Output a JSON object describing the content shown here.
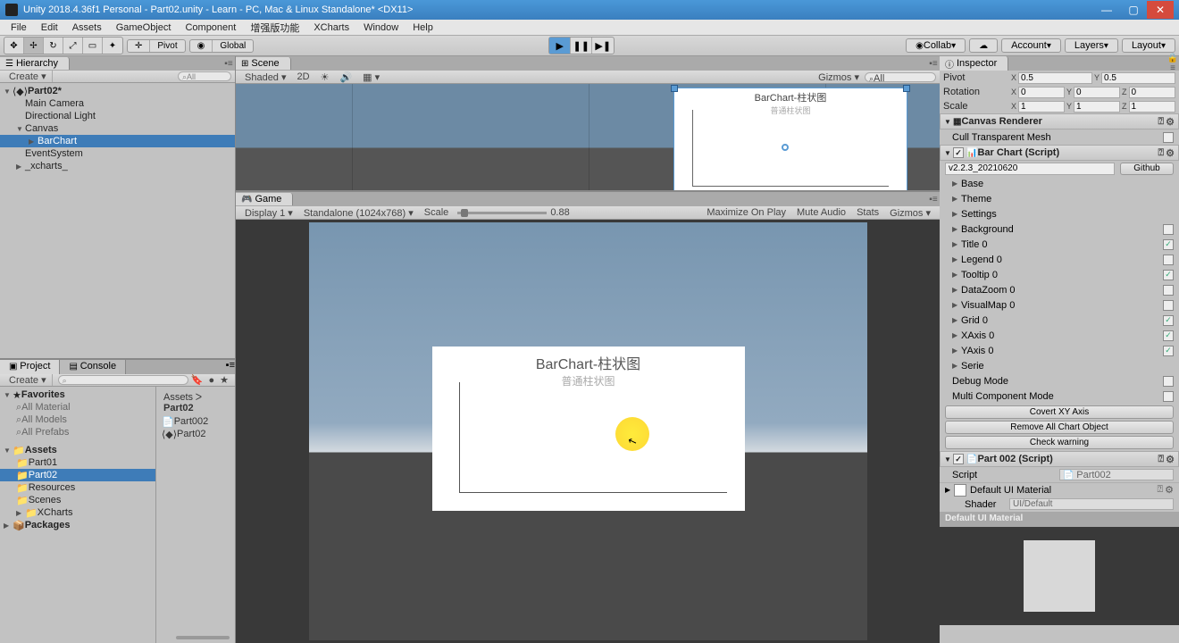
{
  "window": {
    "title": "Unity 2018.4.36f1 Personal - Part02.unity - Learn - PC, Mac & Linux Standalone* <DX11>",
    "min": "—",
    "max": "▢",
    "close": "✕"
  },
  "menu": [
    "File",
    "Edit",
    "Assets",
    "GameObject",
    "Component",
    "增强版功能",
    "XCharts",
    "Window",
    "Help"
  ],
  "toolbar": {
    "pivot": "Pivot",
    "global": "Global",
    "collab": "Collab",
    "account": "Account",
    "layers": "Layers",
    "layout": "Layout"
  },
  "hierarchy": {
    "tab": "Hierarchy",
    "create": "Create",
    "scene": "Part02*",
    "items": [
      "Main Camera",
      "Directional Light",
      "Canvas",
      "BarChart",
      "EventSystem",
      "_xcharts_"
    ]
  },
  "project": {
    "tab1": "Project",
    "tab2": "Console",
    "create": "Create",
    "fav": "Favorites",
    "favs": [
      "All Material",
      "All Models",
      "All Prefabs"
    ],
    "assets": "Assets",
    "folders": [
      "Part01",
      "Part02",
      "Resources",
      "Scenes",
      "XCharts"
    ],
    "packages": "Packages",
    "crumb_root": "Assets",
    "crumb_leaf": "Part02",
    "files": [
      "Part002",
      "Part02"
    ]
  },
  "scene": {
    "tab": "Scene",
    "shaded": "Shaded",
    "mode2d": "2D",
    "gizmos": "Gizmos",
    "search": "All",
    "chart_title": "BarChart-柱状图",
    "chart_sub": "普通柱状图"
  },
  "game": {
    "tab": "Game",
    "display": "Display 1",
    "res": "Standalone (1024x768)",
    "scale_lbl": "Scale",
    "scale_val": "0.88",
    "max": "Maximize On Play",
    "mute": "Mute Audio",
    "stats": "Stats",
    "gizmos": "Gizmos",
    "chart_title": "BarChart-柱状图",
    "chart_sub": "普通柱状图"
  },
  "inspector": {
    "tab": "Inspector",
    "pivot": {
      "label": "Pivot",
      "x": "0.5",
      "y": "0.5"
    },
    "rotation": {
      "label": "Rotation",
      "x": "0",
      "y": "0",
      "z": "0"
    },
    "localscale": {
      "label": "Scale",
      "x": "1",
      "y": "1",
      "z": "1"
    },
    "canvas_renderer": "Canvas Renderer",
    "cull": "Cull Transparent Mesh",
    "barchart_script": "Bar Chart (Script)",
    "version": "v2.2.3_20210620",
    "github": "Github",
    "props": [
      {
        "n": "Base",
        "c": null
      },
      {
        "n": "Theme",
        "c": null
      },
      {
        "n": "Settings",
        "c": null
      },
      {
        "n": "Background",
        "c": false
      },
      {
        "n": "Title 0",
        "c": true
      },
      {
        "n": "Legend 0",
        "c": false
      },
      {
        "n": "Tooltip 0",
        "c": true
      },
      {
        "n": "DataZoom 0",
        "c": false
      },
      {
        "n": "VisualMap 0",
        "c": false
      },
      {
        "n": "Grid 0",
        "c": true
      },
      {
        "n": "XAxis 0",
        "c": true
      },
      {
        "n": "YAxis 0",
        "c": true
      },
      {
        "n": "Serie",
        "c": null
      }
    ],
    "debug": "Debug Mode",
    "multi": "Multi Component Mode",
    "btn_covert": "Covert XY Axis",
    "btn_remove": "Remove All Chart Object",
    "btn_check": "Check warning",
    "part002": "Part 002 (Script)",
    "script_lbl": "Script",
    "script_val": "Part002",
    "mat": "Default UI Material",
    "shader_lbl": "Shader",
    "shader_val": "UI/Default",
    "mat_header": "Default UI Material"
  }
}
